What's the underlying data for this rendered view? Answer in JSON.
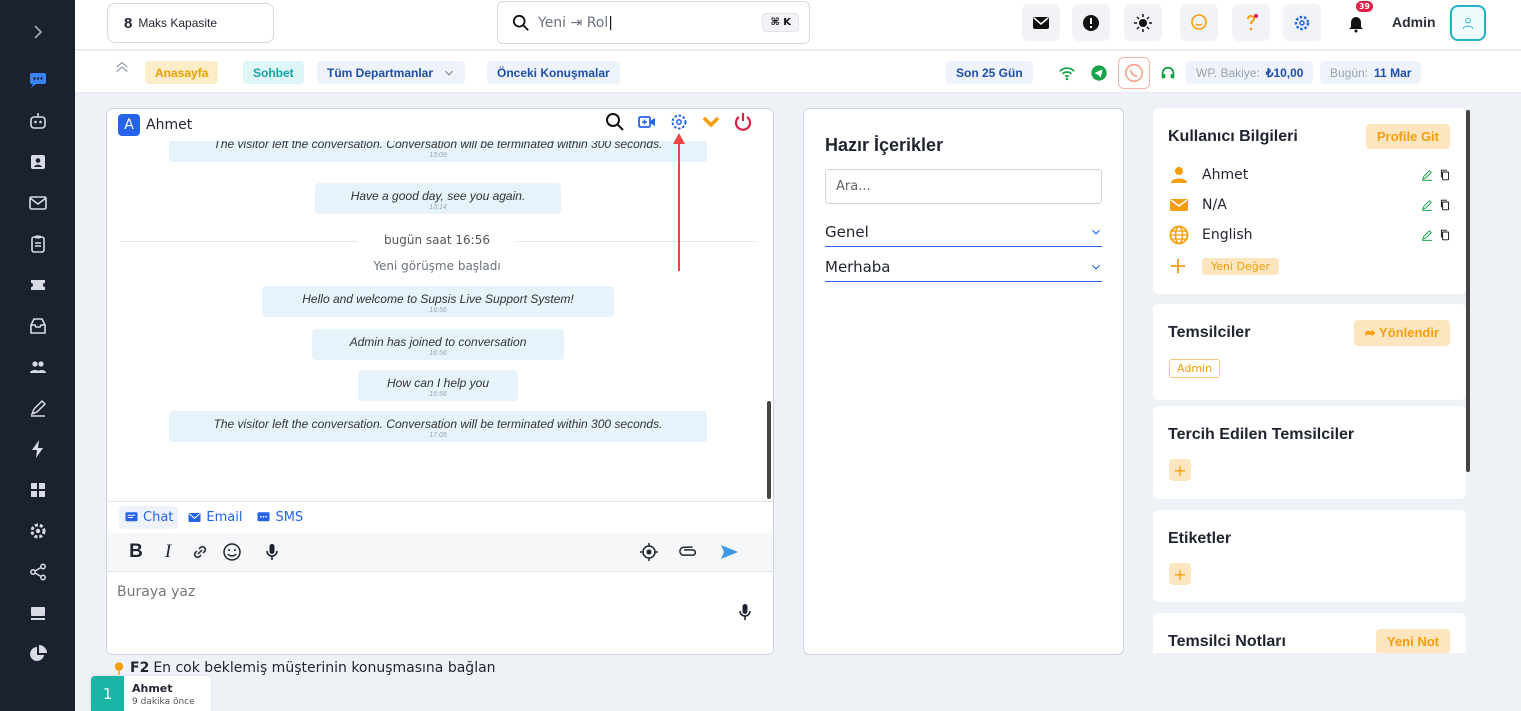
{
  "sidebar": {
    "icons": [
      "chevron-right-icon",
      "chat-icon",
      "bot-icon",
      "contact-card-icon",
      "mail-icon",
      "clipboard-icon",
      "ticket-icon",
      "archive-icon",
      "users-icon",
      "pen-icon",
      "bolt-icon",
      "grid-icon",
      "settings-icon",
      "share-icon",
      "monitor-icon",
      "pie-chart-icon"
    ],
    "active_color": "#3b82f6"
  },
  "topbar": {
    "capacity_value": "8",
    "capacity_label": "Maks Kapasite",
    "search_value": "Yeni ⇥ Rol",
    "search_shortcut": "⌘ K",
    "notification_count": "39",
    "user_name": "Admin"
  },
  "filterbar": {
    "home": "Anasayfa",
    "chat": "Sohbet",
    "departments": "Tüm Departmanlar",
    "previous": "Önceki Konuşmalar",
    "days": "Son 25 Gün",
    "balance_label": "WP. Bakiye:",
    "balance_value": "₺10,00",
    "today_label": "Bugün:",
    "today_value": "11 Mar"
  },
  "chat": {
    "visitor_initial": "A",
    "visitor_name": "Ahmet",
    "messages": [
      {
        "text": "The visitor left the conversation. Conversation will be terminated within 300 seconds.",
        "time": "13:09"
      },
      {
        "text": "Have a good day, see you again.",
        "time": "13:14"
      },
      {
        "text": "Hello and welcome to Supsis Live Support System!",
        "time": "16:56"
      },
      {
        "text": "Admin has joined to conversation",
        "time": "16:56"
      },
      {
        "text": "How can I help you",
        "time": "16:56"
      },
      {
        "text": "The visitor left the conversation. Conversation will be terminated within 300 seconds.",
        "time": "17:05"
      }
    ],
    "divider": "bugün saat 16:56",
    "system_note": "Yeni görüşme başladı",
    "tabs": {
      "chat": "Chat",
      "email": "Email",
      "sms": "SMS"
    },
    "composer_placeholder": "Buraya yaz"
  },
  "canned": {
    "title": "Hazır İçerikler",
    "search_placeholder": "Ara...",
    "groups": [
      "Genel",
      "Merhaba"
    ]
  },
  "user_info": {
    "title": "Kullanıcı Bilgileri",
    "action": "Profile Git",
    "name": "Ahmet",
    "email": "N/A",
    "language": "English",
    "new_value": "Yeni Değer"
  },
  "agents": {
    "title": "Temsilciler",
    "action": "Yönlendir",
    "agent": "Admin"
  },
  "preferred_agents": {
    "title": "Tercih Edilen Temsilciler"
  },
  "tags": {
    "title": "Etiketler"
  },
  "agent_notes": {
    "title": "Temsilci Notları",
    "action": "Yeni Not"
  },
  "footer": {
    "shortcut": "F2",
    "hint": "En cok beklemiş müşterinin konuşmasına bağlan",
    "queue_number": "1",
    "queue_name": "Ahmet",
    "queue_time": "9 dakika önce"
  },
  "colors": {
    "accent": "#2563eb",
    "orange": "#f59e0b",
    "teal": "#15a3a3",
    "sidebar": "#1c2130"
  }
}
